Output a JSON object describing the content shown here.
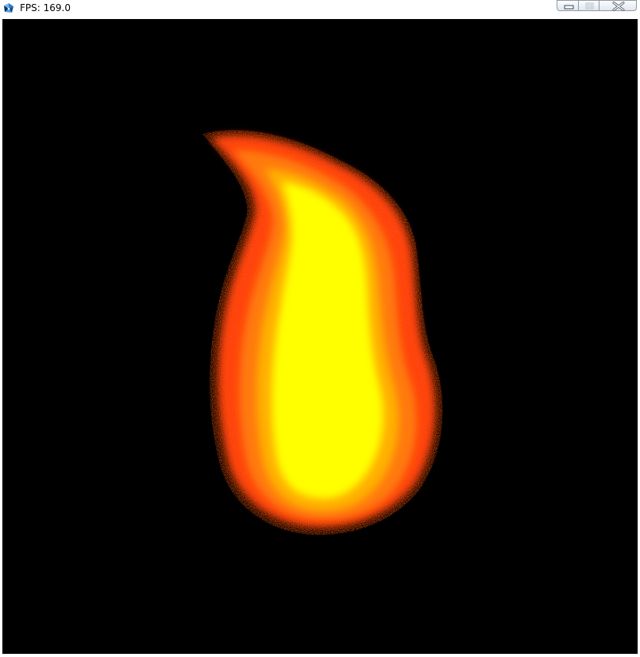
{
  "window": {
    "title": "FPS: 169.0",
    "app_icon": "pinwheel-app-icon",
    "buttons": {
      "minimize_icon": "minimize-icon",
      "maximize_icon": "maximize-icon",
      "close_icon": "close-icon"
    }
  },
  "scene": {
    "background": "#000000",
    "flame_colors": {
      "core": "#ffff00",
      "mid": "#ffb000",
      "outer": "#ff5a10",
      "edge": "#ff3c0a"
    }
  }
}
